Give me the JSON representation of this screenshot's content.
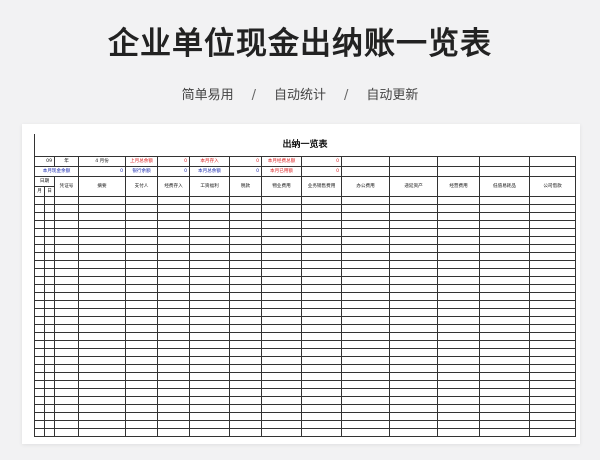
{
  "page": {
    "title": "企业单位现金出纳账一览表",
    "tags": [
      "简单易用",
      "自动统计",
      "自动更新"
    ],
    "separator": "/"
  },
  "sheet": {
    "title": "出纳一览表",
    "year": "09",
    "year_label": "年",
    "month": "4",
    "month_label": "月份",
    "info_row1": [
      {
        "label": "上月总余额",
        "value": "0"
      },
      {
        "label": "本月存入",
        "value": "0"
      },
      {
        "label": "本月经费总额",
        "value": "0"
      }
    ],
    "info_row2": [
      {
        "label": "本月现金余额",
        "value": "0"
      },
      {
        "label": "银行余额",
        "value": "0"
      },
      {
        "label": "本月总余额",
        "value": "0"
      },
      {
        "label": "本月已用额",
        "value": "0"
      }
    ],
    "date_label": "日期",
    "month_col": "月",
    "day_col": "日",
    "columns": [
      "凭证号",
      "摘要",
      "支付人",
      "经费存入",
      "工资福利",
      "税款",
      "物业费用",
      "业务销售费用",
      "办公费用",
      "递延资产",
      "经营费用",
      "低值易耗品",
      "公司借款"
    ]
  }
}
